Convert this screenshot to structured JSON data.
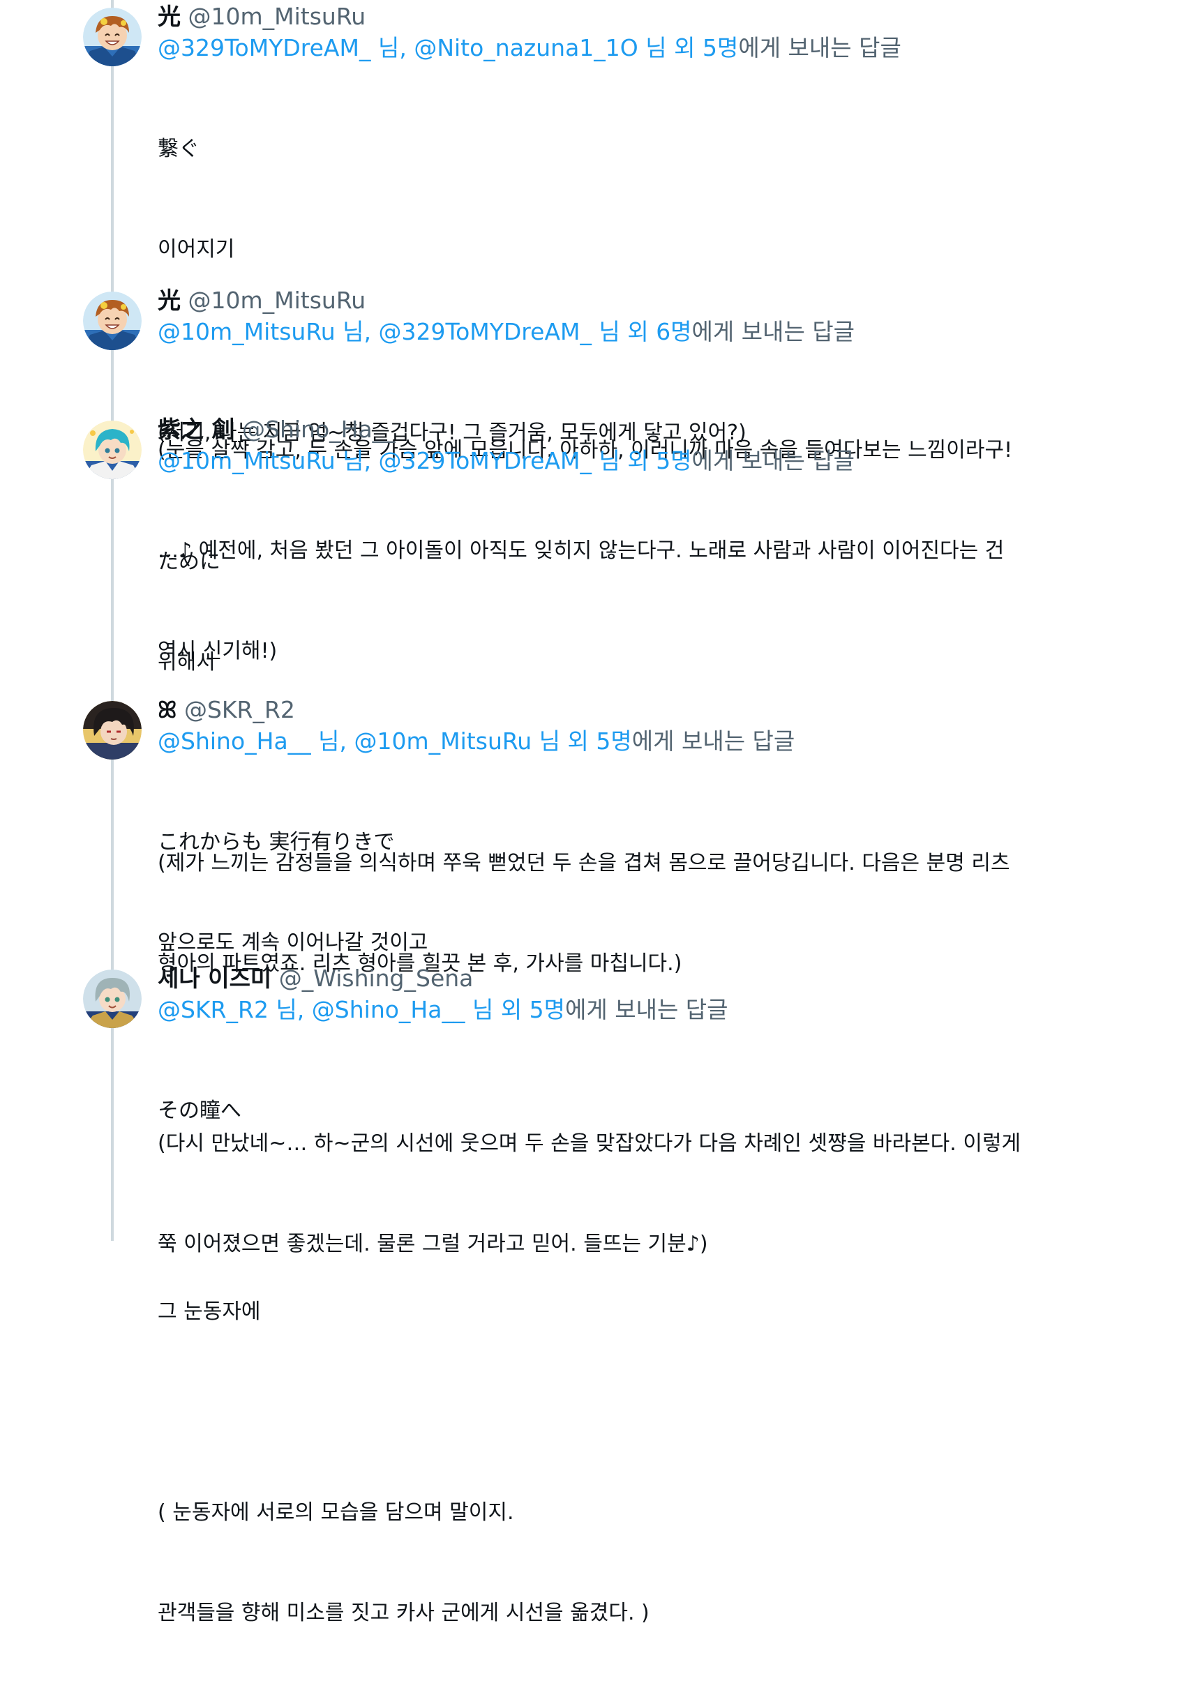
{
  "tweets": [
    {
      "display_name": "光",
      "handle": "@10m_MitsuRu",
      "avatar_icon": "avatar-orange-hair-icon",
      "reply_mention_1": "@329ToMYDreAM_",
      "reply_sep_1": " 님, ",
      "reply_mention_2": "@Nito_nazuna1_1O",
      "reply_sep_2": " 님 외 5명",
      "reply_suffix": "에게 보내는 답글",
      "lines": [
        "繋ぐ",
        "이어지기",
        "",
        "(눈을 살짝 감고, 두 손을 가슴 앞에 모읍니다. 아하하, 이러니까 마음 속을 들여다보는 느낌이라구!",
        "…♪ 예전에, 처음 봤던 그 아이돌이 아직도 잊히지 않는다구. 노래로 사람과 사람이 이어진다는 건",
        "역시 신기해!)"
      ]
    },
    {
      "display_name": "光",
      "handle": "@10m_MitsuRu",
      "avatar_icon": "avatar-orange-hair-icon",
      "reply_mention_1": "@10m_MitsuRu",
      "reply_sep_1": " 님, ",
      "reply_mention_2": "@329ToMYDreAM_",
      "reply_sep_2": " 님 외 6명",
      "reply_suffix": "에게 보내는 답글",
      "lines": [
        "(저기, 나는 지금 엄~청 즐겁다구! 그 즐거움, 모두에게 닿고 있어?)"
      ]
    },
    {
      "display_name": "紫之 創",
      "handle": "@Shino_Ha__",
      "avatar_icon": "avatar-teal-hair-icon",
      "reply_mention_1": "@10m_MitsuRu",
      "reply_sep_1": " 님, ",
      "reply_mention_2": "@329ToMYDreAM_",
      "reply_sep_2": " 님 외 5명",
      "reply_suffix": "에게 보내는 답글",
      "lines": [
        "ために",
        "위해서",
        "",
        "(제가 느끼는 감정들을 의식하며 쭈욱 뻗었던 두 손을 겹쳐 몸으로 끌어당깁니다. 다음은 분명 리츠",
        "형아의 파트였죠. 리츠 형아를 힐끗 본 후, 가사를 마칩니다.)"
      ]
    },
    {
      "display_name": "ꕤ",
      "handle": "@SKR_R2",
      "avatar_icon": "avatar-dark-hair-icon",
      "reply_mention_1": "@Shino_Ha__",
      "reply_sep_1": " 님, ",
      "reply_mention_2": "@10m_MitsuRu",
      "reply_sep_2": " 님 외 5명",
      "reply_suffix": "에게 보내는 답글",
      "lines": [
        "これからも 実行有りきで",
        "앞으로도 계속 이어나갈 것이고",
        "",
        "(다시 만났네~… 하~군의 시선에 웃으며 두 손을 맞잡았다가 다음 차례인 셋쨩을 바라본다. 이렇게",
        "쭉 이어졌으면 좋겠는데. 물론 그럴 거라고 믿어. 들뜨는 기분♪)"
      ]
    },
    {
      "display_name": "세나 이즈미",
      "handle": "@_Wishing_Sena",
      "avatar_icon": "avatar-silver-hair-icon",
      "reply_mention_1": "@SKR_R2",
      "reply_sep_1": " 님, ",
      "reply_mention_2": "@Shino_Ha__",
      "reply_sep_2": " 님 외 5명",
      "reply_suffix": "에게 보내는 답글",
      "lines": [
        "その瞳へ",
        "",
        "그 눈동자에",
        "",
        "( 눈동자에 서로의 모습을 담으며 말이지.",
        "관객들을 향해 미소를 짓고 카사 군에게 시선을 옮겼다. )"
      ]
    }
  ]
}
